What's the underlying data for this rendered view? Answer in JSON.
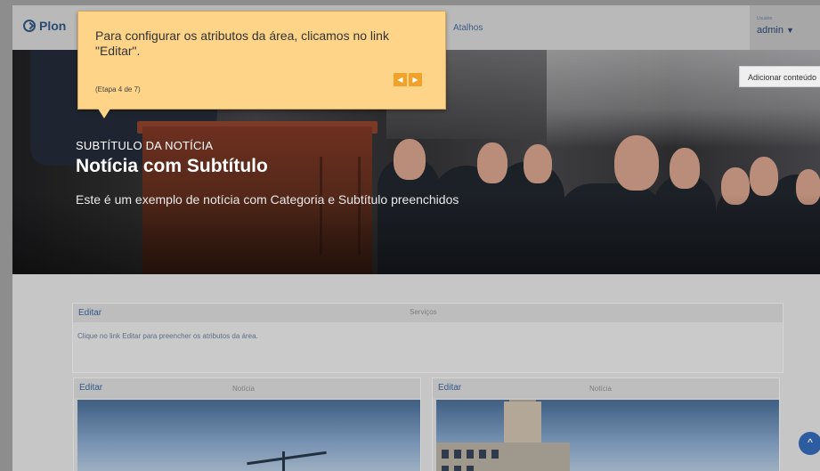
{
  "header": {
    "logo_text": "Plon",
    "nav_atalhos": "Atalhos",
    "user_caption": "Usuário",
    "user_name": "admin",
    "user_caret": "▼"
  },
  "toolbar": {
    "add_content": "Adicionar conteúdo"
  },
  "tour": {
    "text": "Para configurar os atributos da área, clicamos no link \"Editar\".",
    "step": "(Etapa 4 de 7)",
    "prev_icon": "◀",
    "next_icon": "▶"
  },
  "hero": {
    "subtitle": "SUBTÍTULO DA NOTÍCIA",
    "title": "Notícia com Subtítulo",
    "description": "Este é um exemplo de notícia com Categoria e Subtítulo preenchidos"
  },
  "services": {
    "edit": "Editar",
    "title": "Serviços",
    "body": "Clique no link Editar para preencher os atributos da área."
  },
  "cards": [
    {
      "edit": "Editar",
      "title": "Notícia"
    },
    {
      "edit": "Editar",
      "title": "Notícia"
    }
  ],
  "scroll_top_icon": "^"
}
